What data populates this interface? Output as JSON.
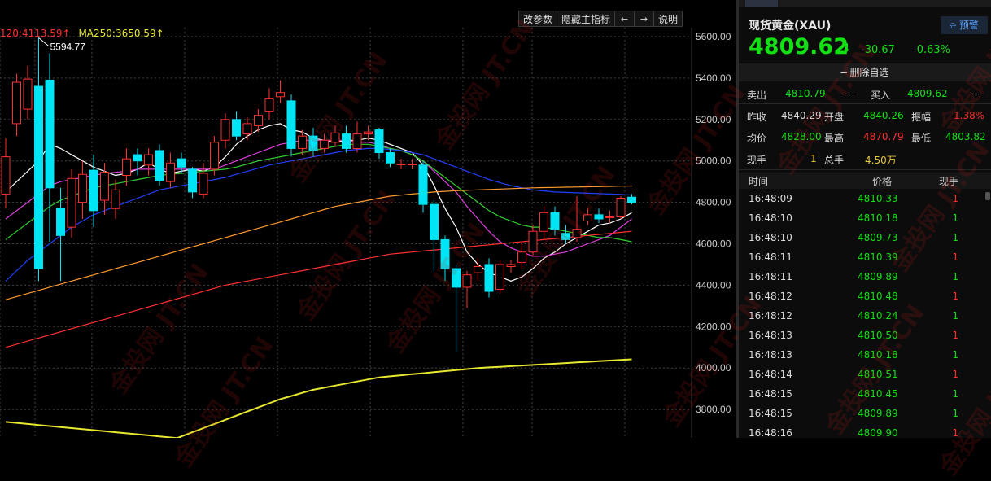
{
  "toolbar": {
    "params_label": "改参数",
    "hide_label": "隐藏主指标",
    "left_arrow": "←",
    "right_arrow": "→",
    "help_label": "说明"
  },
  "legend": {
    "ma120": "120:4113.59↑",
    "ma250": "MA250:3650.59↑",
    "ma120_color": "#ff3030",
    "ma250_color": "#e8e830"
  },
  "watermark_text": "金投网 JT.CN",
  "quote": {
    "name": "现货黄金(XAU)",
    "alert_label": "预警",
    "price": "4809.62",
    "change": "-30.67",
    "change_pct": "-0.63%",
    "watch_label": "删除自选",
    "sell_label": "卖出",
    "sell": "4810.79",
    "sell_extra": "---",
    "buy_label": "买入",
    "buy": "4809.62",
    "buy_extra": "---",
    "prev_label": "昨收",
    "prev": "4840.29",
    "open_label": "开盘",
    "open": "4840.26",
    "amp_label": "振幅",
    "amp": "1.38%",
    "avg_label": "均价",
    "avg": "4828.00",
    "high_label": "最高",
    "high": "4870.79",
    "low_label": "最低",
    "low": "4803.82",
    "cur_vol_label": "现手",
    "cur_vol": "1",
    "total_vol_label": "总手",
    "total_vol": "4.50万"
  },
  "ticks": {
    "headers": [
      "时间",
      "价格",
      "现手"
    ],
    "rows": [
      {
        "time": "16:48:09",
        "price": "4810.33",
        "vol": "1",
        "dir": "up"
      },
      {
        "time": "16:48:10",
        "price": "4810.18",
        "vol": "1",
        "dir": "down"
      },
      {
        "time": "16:48:10",
        "price": "4809.73",
        "vol": "1",
        "dir": "down"
      },
      {
        "time": "16:48:11",
        "price": "4810.39",
        "vol": "1",
        "dir": "up"
      },
      {
        "time": "16:48:11",
        "price": "4809.89",
        "vol": "1",
        "dir": "down"
      },
      {
        "time": "16:48:12",
        "price": "4810.48",
        "vol": "1",
        "dir": "up"
      },
      {
        "time": "16:48:12",
        "price": "4810.24",
        "vol": "1",
        "dir": "down"
      },
      {
        "time": "16:48:13",
        "price": "4810.50",
        "vol": "1",
        "dir": "up"
      },
      {
        "time": "16:48:13",
        "price": "4810.18",
        "vol": "1",
        "dir": "down"
      },
      {
        "time": "16:48:14",
        "price": "4810.51",
        "vol": "1",
        "dir": "up"
      },
      {
        "time": "16:48:15",
        "price": "4810.45",
        "vol": "1",
        "dir": "down"
      },
      {
        "time": "16:48:15",
        "price": "4809.89",
        "vol": "1",
        "dir": "down"
      },
      {
        "time": "16:48:16",
        "price": "4809.90",
        "vol": "1",
        "dir": "up"
      }
    ]
  },
  "chart_data": {
    "type": "candlestick",
    "ylim": [
      3720,
      5600
    ],
    "y_ticks": [
      "5600.00",
      "5400.00",
      "5200.00",
      "5000.00",
      "4800.00",
      "4600.00",
      "4400.00",
      "4200.00",
      "4000.00",
      "3800.00"
    ],
    "annotation": "5594.77",
    "up_color": "#ff3030",
    "down_color": "#00e5f5",
    "candles": [
      {
        "o": 4840,
        "c": 5020,
        "h": 5110,
        "l": 4770
      },
      {
        "o": 5180,
        "c": 5380,
        "h": 5420,
        "l": 5120
      },
      {
        "o": 5250,
        "c": 5395,
        "h": 5460,
        "l": 5200
      },
      {
        "o": 5360,
        "c": 4480,
        "h": 5594.77,
        "l": 4420
      },
      {
        "o": 5390,
        "c": 4870,
        "h": 5520,
        "l": 4610
      },
      {
        "o": 4770,
        "c": 4640,
        "h": 4870,
        "l": 4420
      },
      {
        "o": 4680,
        "c": 4915,
        "h": 4960,
        "l": 4630
      },
      {
        "o": 4800,
        "c": 4935,
        "h": 5000,
        "l": 4720
      },
      {
        "o": 4955,
        "c": 4760,
        "h": 5030,
        "l": 4680
      },
      {
        "o": 4810,
        "c": 4945,
        "h": 4990,
        "l": 4740
      },
      {
        "o": 4770,
        "c": 4860,
        "h": 4910,
        "l": 4720
      },
      {
        "o": 4930,
        "c": 5010,
        "h": 5060,
        "l": 4880
      },
      {
        "o": 5030,
        "c": 5000,
        "h": 5060,
        "l": 4930
      },
      {
        "o": 4980,
        "c": 5030,
        "h": 5060,
        "l": 4930
      },
      {
        "o": 5050,
        "c": 4905,
        "h": 5080,
        "l": 4880
      },
      {
        "o": 4900,
        "c": 4990,
        "h": 5040,
        "l": 4870
      },
      {
        "o": 5010,
        "c": 4970,
        "h": 5040,
        "l": 4940
      },
      {
        "o": 4960,
        "c": 4850,
        "h": 4970,
        "l": 4820
      },
      {
        "o": 4840,
        "c": 4940,
        "h": 4990,
        "l": 4820
      },
      {
        "o": 4960,
        "c": 5090,
        "h": 5120,
        "l": 4930
      },
      {
        "o": 5100,
        "c": 5200,
        "h": 5230,
        "l": 5060
      },
      {
        "o": 5200,
        "c": 5120,
        "h": 5240,
        "l": 5100
      },
      {
        "o": 5130,
        "c": 5180,
        "h": 5210,
        "l": 5100
      },
      {
        "o": 5170,
        "c": 5220,
        "h": 5250,
        "l": 5140
      },
      {
        "o": 5240,
        "c": 5300,
        "h": 5350,
        "l": 5200
      },
      {
        "o": 5310,
        "c": 5330,
        "h": 5390,
        "l": 5280
      },
      {
        "o": 5290,
        "c": 5060,
        "h": 5320,
        "l": 5020
      },
      {
        "o": 5060,
        "c": 5120,
        "h": 5150,
        "l": 5030
      },
      {
        "o": 5120,
        "c": 5050,
        "h": 5160,
        "l": 5020
      },
      {
        "o": 5060,
        "c": 5100,
        "h": 5130,
        "l": 5040
      },
      {
        "o": 5090,
        "c": 5135,
        "h": 5170,
        "l": 5070
      },
      {
        "o": 5130,
        "c": 5060,
        "h": 5170,
        "l": 5040
      },
      {
        "o": 5060,
        "c": 5130,
        "h": 5190,
        "l": 5040
      },
      {
        "o": 5130,
        "c": 5140,
        "h": 5170,
        "l": 5100
      },
      {
        "o": 5150,
        "c": 5040,
        "h": 5160,
        "l": 5010
      },
      {
        "o": 5040,
        "c": 4990,
        "h": 5060,
        "l": 4970
      },
      {
        "o": 4985,
        "c": 4985,
        "h": 5010,
        "l": 4960
      },
      {
        "o": 4985,
        "c": 4985,
        "h": 5010,
        "l": 4960
      },
      {
        "o": 4980,
        "c": 4790,
        "h": 5000,
        "l": 4750
      },
      {
        "o": 4790,
        "c": 4620,
        "h": 4810,
        "l": 4470
      },
      {
        "o": 4620,
        "c": 4480,
        "h": 4640,
        "l": 4420
      },
      {
        "o": 4480,
        "c": 4390,
        "h": 4500,
        "l": 4080
      },
      {
        "o": 4390,
        "c": 4450,
        "h": 4470,
        "l": 4290
      },
      {
        "o": 4460,
        "c": 4490,
        "h": 4530,
        "l": 4420
      },
      {
        "o": 4500,
        "c": 4370,
        "h": 4530,
        "l": 4340
      },
      {
        "o": 4380,
        "c": 4500,
        "h": 4520,
        "l": 4360
      },
      {
        "o": 4490,
        "c": 4500,
        "h": 4520,
        "l": 4460
      },
      {
        "o": 4510,
        "c": 4560,
        "h": 4600,
        "l": 4480
      },
      {
        "o": 4560,
        "c": 4660,
        "h": 4690,
        "l": 4540
      },
      {
        "o": 4660,
        "c": 4750,
        "h": 4780,
        "l": 4620
      },
      {
        "o": 4750,
        "c": 4670,
        "h": 4780,
        "l": 4640
      },
      {
        "o": 4650,
        "c": 4620,
        "h": 4690,
        "l": 4600
      },
      {
        "o": 4630,
        "c": 4670,
        "h": 4830,
        "l": 4610
      },
      {
        "o": 4710,
        "c": 4740,
        "h": 4770,
        "l": 4690
      },
      {
        "o": 4740,
        "c": 4720,
        "h": 4770,
        "l": 4700
      },
      {
        "o": 4730,
        "c": 4730,
        "h": 4760,
        "l": 4700
      },
      {
        "o": 4730,
        "c": 4820,
        "h": 4830,
        "l": 4720
      },
      {
        "o": 4825,
        "c": 4800,
        "h": 4840,
        "l": 4790
      }
    ],
    "ma_lines": [
      {
        "color": "#ffffff",
        "values": [
          4850,
          4900,
          4950,
          5000,
          5080,
          5060,
          5030,
          5000,
          4970,
          4950,
          4930,
          4940,
          4960,
          4990,
          4960,
          4940,
          4950,
          4960,
          4950,
          4970,
          5020,
          5080,
          5120,
          5150,
          5170,
          5180,
          5150,
          5140,
          5110,
          5100,
          5090,
          5100,
          5100,
          5110,
          5100,
          5080,
          5060,
          5040,
          4980,
          4880,
          4770,
          4680,
          4560,
          4500,
          4460,
          4440,
          4420,
          4440,
          4480,
          4530,
          4560,
          4600,
          4630,
          4660,
          4690,
          4700,
          4720,
          4750
        ]
      },
      {
        "color": "#e040e0",
        "values": [
          4720,
          4760,
          4800,
          4840,
          4880,
          4900,
          4910,
          4920,
          4930,
          4940,
          4945,
          4950,
          4960,
          4960,
          4960,
          4960,
          4960,
          4960,
          4960,
          4960,
          4980,
          5000,
          5020,
          5040,
          5060,
          5080,
          5090,
          5100,
          5100,
          5100,
          5100,
          5100,
          5090,
          5090,
          5080,
          5060,
          5050,
          5030,
          5000,
          4950,
          4900,
          4850,
          4780,
          4720,
          4660,
          4610,
          4580,
          4560,
          4540,
          4540,
          4550,
          4560,
          4580,
          4600,
          4620,
          4640,
          4680,
          4720
        ]
      },
      {
        "color": "#30d030",
        "values": [
          4620,
          4660,
          4700,
          4740,
          4780,
          4810,
          4830,
          4850,
          4870,
          4880,
          4890,
          4900,
          4910,
          4920,
          4930,
          4935,
          4940,
          4945,
          4950,
          4955,
          4960,
          4970,
          4985,
          5000,
          5010,
          5020,
          5030,
          5040,
          5050,
          5060,
          5070,
          5080,
          5080,
          5080,
          5070,
          5060,
          5050,
          5030,
          5000,
          4960,
          4920,
          4880,
          4840,
          4800,
          4760,
          4730,
          4710,
          4690,
          4680,
          4680,
          4670,
          4660,
          4650,
          4640,
          4630,
          4630,
          4620,
          4610
        ]
      },
      {
        "color": "#2040ff",
        "values": [
          4420,
          4470,
          4520,
          4560,
          4600,
          4640,
          4680,
          4710,
          4740,
          4760,
          4780,
          4800,
          4820,
          4840,
          4860,
          4870,
          4880,
          4890,
          4900,
          4910,
          4920,
          4935,
          4950,
          4965,
          4980,
          4990,
          5000,
          5010,
          5020,
          5030,
          5040,
          5050,
          5055,
          5060,
          5060,
          5055,
          5050,
          5040,
          5030,
          5010,
          4990,
          4970,
          4950,
          4930,
          4910,
          4895,
          4880,
          4870,
          4860,
          4855,
          4850,
          4848,
          4846,
          4844,
          4842,
          4840,
          4838,
          4835
        ]
      },
      {
        "color": "#ff9a30",
        "values": [
          4330,
          4345,
          4360,
          4375,
          4390,
          4405,
          4420,
          4435,
          4450,
          4465,
          4480,
          4495,
          4510,
          4525,
          4540,
          4555,
          4570,
          4585,
          4600,
          4615,
          4630,
          4645,
          4660,
          4675,
          4690,
          4705,
          4720,
          4735,
          4750,
          4765,
          4780,
          4790,
          4800,
          4810,
          4820,
          4830,
          4835,
          4840,
          4845,
          4850,
          4853,
          4856,
          4858,
          4860,
          4862,
          4864,
          4866,
          4868,
          4870,
          4871,
          4872,
          4873,
          4874,
          4875,
          4876,
          4877,
          4878,
          4879
        ]
      },
      {
        "color": "#ff3030",
        "values": [
          4100,
          4115,
          4130,
          4145,
          4160,
          4175,
          4190,
          4205,
          4220,
          4235,
          4250,
          4265,
          4280,
          4295,
          4310,
          4325,
          4340,
          4355,
          4370,
          4385,
          4400,
          4410,
          4420,
          4430,
          4440,
          4450,
          4460,
          4470,
          4480,
          4490,
          4500,
          4510,
          4520,
          4530,
          4540,
          4550,
          4555,
          4560,
          4565,
          4570,
          4575,
          4580,
          4585,
          4590,
          4595,
          4600,
          4605,
          4610,
          4615,
          4620,
          4625,
          4630,
          4635,
          4640,
          4645,
          4650,
          4655,
          4660
        ]
      },
      {
        "color": "#e8e830",
        "values": [
          null,
          null,
          null,
          null,
          null,
          null,
          null,
          null,
          null,
          null,
          null,
          null,
          null,
          null,
          null,
          3650,
          3670,
          3690,
          3710,
          3730,
          3750,
          3770,
          3790,
          3810,
          3830,
          3850,
          3865,
          3880,
          3895,
          3905,
          3915,
          3925,
          3935,
          3945,
          3955,
          3960,
          3965,
          3970,
          3975,
          3980,
          3985,
          3990,
          3995,
          4000,
          4003,
          4006,
          4009,
          4012,
          4015,
          4018,
          4021,
          4024,
          4027,
          4030,
          4033,
          4036,
          4039,
          4042
        ]
      },
      {
        "color": "#e8e830",
        "values": [
          3740,
          3735,
          3730,
          3725,
          3720,
          3715,
          3710,
          3705,
          3700,
          3695,
          3690,
          3685,
          3680,
          3675,
          3670,
          3665,
          3660,
          null,
          null,
          null,
          null,
          null,
          null,
          null,
          null,
          null,
          null,
          null,
          null,
          null,
          null,
          null,
          null,
          null,
          null,
          null,
          null,
          null,
          null,
          null,
          null,
          null,
          null,
          null,
          null,
          null,
          null,
          null,
          null,
          null,
          null,
          null,
          null,
          null,
          null,
          null,
          null,
          null
        ]
      }
    ]
  }
}
